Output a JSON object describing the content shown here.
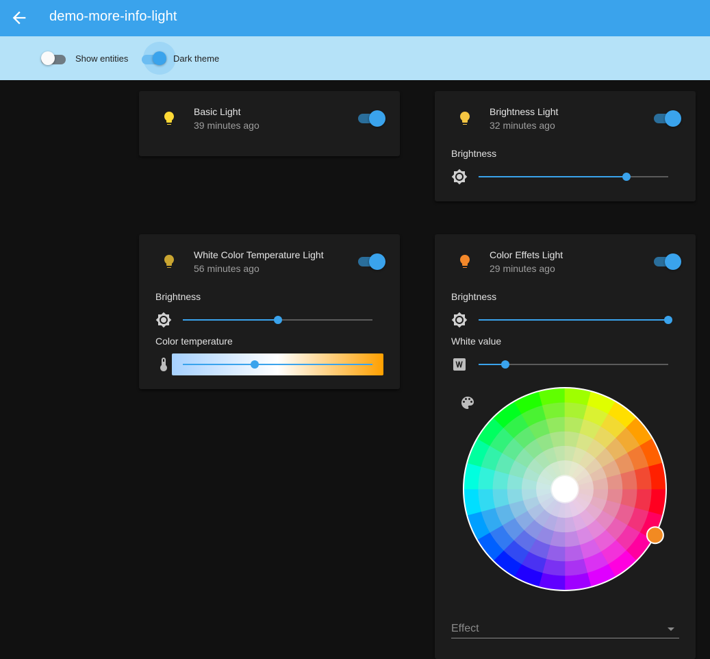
{
  "app": {
    "title": "demo-more-info-light"
  },
  "toolbar": {
    "show_entities": {
      "label": "Show entities",
      "checked": false
    },
    "dark_theme": {
      "label": "Dark theme",
      "checked": true
    }
  },
  "colors": {
    "accent": "#3aa3ec",
    "card": "#1c1c1c",
    "background": "#111111",
    "header": "#3aa3ec",
    "toolbar": "#b5e2f8"
  },
  "cards": {
    "basic": {
      "name": "Basic Light",
      "time": "39 minutes ago",
      "on": true,
      "icon": "lightbulb-icon",
      "icon_color": "#fdd835"
    },
    "brightness": {
      "name": "Brightness Light",
      "time": "32 minutes ago",
      "on": true,
      "icon": "lightbulb-icon",
      "icon_color": "#f4c542",
      "brightness_label": "Brightness",
      "brightness": 0.78
    },
    "white_temp": {
      "name": "White Color Temperature Light",
      "time": "56 minutes ago",
      "on": true,
      "icon": "lightbulb-icon",
      "icon_color": "#c9a531",
      "brightness_label": "Brightness",
      "brightness": 0.5,
      "ct_label": "Color temperature",
      "color_temp": 0.38
    },
    "color_effects": {
      "name": "Color Effets Light",
      "time": "29 minutes ago",
      "on": true,
      "icon": "lightbulb-icon",
      "icon_color": "#f4882a",
      "brightness_label": "Brightness",
      "brightness": 1.0,
      "white_label": "White value",
      "white_value": 0.14,
      "effect_placeholder": "Effect",
      "selected_color": "#f28a22"
    }
  }
}
